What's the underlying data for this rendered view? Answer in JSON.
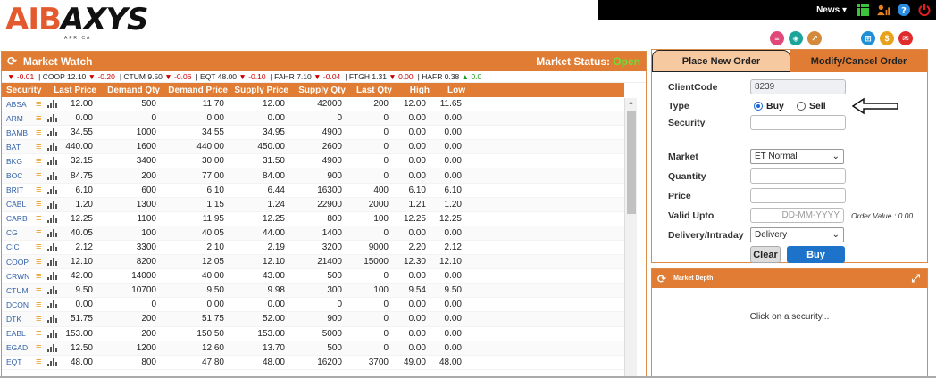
{
  "brand": {
    "logo_main_a": "AIB",
    "logo_main_b": "AXYS",
    "logo_sub": "AFRICA"
  },
  "topbar": {
    "news_label": "News ▾",
    "icons": [
      "grid-icon",
      "user-chart-icon",
      "help-icon",
      "power-icon"
    ]
  },
  "quick_icons": {
    "left": [
      {
        "name": "database-icon",
        "color": "#e0487a"
      },
      {
        "name": "layers-icon",
        "color": "#1ba59a"
      },
      {
        "name": "chart-swirl-icon",
        "color": "#d38a3a"
      }
    ],
    "right": [
      {
        "name": "cart-icon",
        "color": "#1f8fd6"
      },
      {
        "name": "coin-icon",
        "color": "#e8a21a"
      },
      {
        "name": "message-icon",
        "color": "#e02c2c"
      }
    ]
  },
  "market_watch": {
    "title": "Market Watch",
    "status_label": "Market Status:",
    "status_value": "Open",
    "ticker": [
      {
        "sym": "",
        "price": "",
        "chg": "-0.01",
        "dir": "down"
      },
      {
        "sym": "COOP",
        "price": "12.10",
        "chg": "-0.20",
        "dir": "down"
      },
      {
        "sym": "CTUM",
        "price": "9.50",
        "chg": "-0.06",
        "dir": "down"
      },
      {
        "sym": "EQT",
        "price": "48.00",
        "chg": "-0.10",
        "dir": "down"
      },
      {
        "sym": "FAHR",
        "price": "7.10",
        "chg": "-0.04",
        "dir": "down"
      },
      {
        "sym": "FTGH",
        "price": "1.31",
        "chg": "0.00",
        "dir": "down"
      },
      {
        "sym": "HAFR",
        "price": "0.38",
        "chg": "0.0",
        "dir": "up"
      }
    ],
    "columns": [
      "Security",
      "Last Price",
      "Demand Qty",
      "Demand Price",
      "Supply Price",
      "Supply Qty",
      "Last Qty",
      "High",
      "Low"
    ],
    "rows": [
      [
        "ABSA",
        "12.00",
        "500",
        "11.70",
        "12.00",
        "42000",
        "200",
        "12.00",
        "11.65"
      ],
      [
        "ARM",
        "0.00",
        "0",
        "0.00",
        "0.00",
        "0",
        "0",
        "0.00",
        "0.00"
      ],
      [
        "BAMB",
        "34.55",
        "1000",
        "34.55",
        "34.95",
        "4900",
        "0",
        "0.00",
        "0.00"
      ],
      [
        "BAT",
        "440.00",
        "1600",
        "440.00",
        "450.00",
        "2600",
        "0",
        "0.00",
        "0.00"
      ],
      [
        "BKG",
        "32.15",
        "3400",
        "30.00",
        "31.50",
        "4900",
        "0",
        "0.00",
        "0.00"
      ],
      [
        "BOC",
        "84.75",
        "200",
        "77.00",
        "84.00",
        "900",
        "0",
        "0.00",
        "0.00"
      ],
      [
        "BRIT",
        "6.10",
        "600",
        "6.10",
        "6.44",
        "16300",
        "400",
        "6.10",
        "6.10"
      ],
      [
        "CABL",
        "1.20",
        "1300",
        "1.15",
        "1.24",
        "22900",
        "2000",
        "1.21",
        "1.20"
      ],
      [
        "CARB",
        "12.25",
        "1100",
        "11.95",
        "12.25",
        "800",
        "100",
        "12.25",
        "12.25"
      ],
      [
        "CG",
        "40.05",
        "100",
        "40.05",
        "44.00",
        "1400",
        "0",
        "0.00",
        "0.00"
      ],
      [
        "CIC",
        "2.12",
        "3300",
        "2.10",
        "2.19",
        "3200",
        "9000",
        "2.20",
        "2.12"
      ],
      [
        "COOP",
        "12.10",
        "8200",
        "12.05",
        "12.10",
        "21400",
        "15000",
        "12.30",
        "12.10"
      ],
      [
        "CRWN",
        "42.00",
        "14000",
        "40.00",
        "43.00",
        "500",
        "0",
        "0.00",
        "0.00"
      ],
      [
        "CTUM",
        "9.50",
        "10700",
        "9.50",
        "9.98",
        "300",
        "100",
        "9.54",
        "9.50"
      ],
      [
        "DCON",
        "0.00",
        "0",
        "0.00",
        "0.00",
        "0",
        "0",
        "0.00",
        "0.00"
      ],
      [
        "DTK",
        "51.75",
        "200",
        "51.75",
        "52.00",
        "900",
        "0",
        "0.00",
        "0.00"
      ],
      [
        "EABL",
        "153.00",
        "200",
        "150.50",
        "153.00",
        "5000",
        "0",
        "0.00",
        "0.00"
      ],
      [
        "EGAD",
        "12.50",
        "1200",
        "12.60",
        "13.70",
        "500",
        "0",
        "0.00",
        "0.00"
      ],
      [
        "EQT",
        "48.00",
        "800",
        "47.80",
        "48.00",
        "16200",
        "3700",
        "49.00",
        "48.00"
      ]
    ]
  },
  "order": {
    "tab_place": "Place New Order",
    "tab_modify": "Modify/Cancel Order",
    "client_code_label": "ClientCode",
    "client_code_value": "8239",
    "type_label": "Type",
    "type_buy": "Buy",
    "type_sell": "Sell",
    "security_label": "Security",
    "security_value": "",
    "market_label": "Market",
    "market_value": "ET Normal",
    "quantity_label": "Quantity",
    "price_label": "Price",
    "valid_upto_label": "Valid Upto",
    "valid_upto_placeholder": "DD-MM-YYYY",
    "order_value_text": "Order Value : 0.00",
    "delivery_label": "Delivery/Intraday",
    "delivery_value": "Delivery",
    "clear_label": "Clear",
    "buy_label": "Buy"
  },
  "market_depth": {
    "title": "Market Depth",
    "message": "Click on a security..."
  }
}
